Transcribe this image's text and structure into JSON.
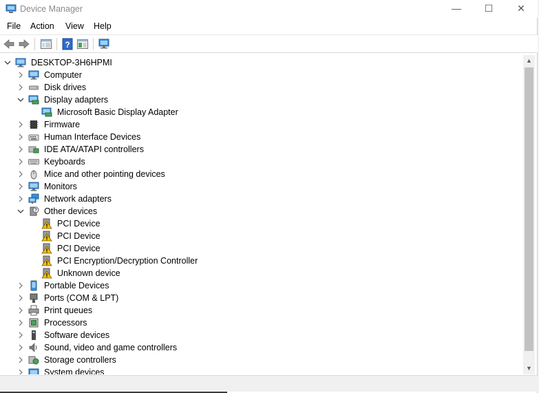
{
  "window": {
    "title": "Device Manager",
    "controls": {
      "minimize": "—",
      "maximize": "☐",
      "close": "✕"
    }
  },
  "menu": [
    {
      "id": "file",
      "label": "File"
    },
    {
      "id": "action",
      "label": "Action"
    },
    {
      "id": "view",
      "label": "View"
    },
    {
      "id": "help",
      "label": "Help"
    }
  ],
  "toolbar": [
    {
      "name": "back-button",
      "icon": "back-arrow-icon"
    },
    {
      "name": "forward-button",
      "icon": "forward-arrow-icon"
    },
    {
      "name": "show-hide-console-tree-button",
      "icon": "console-tree-icon"
    },
    {
      "name": "help-button",
      "icon": "help-icon"
    },
    {
      "name": "properties-button",
      "icon": "properties-icon"
    },
    {
      "name": "scan-hardware-button",
      "icon": "monitor-scan-icon"
    }
  ],
  "tree": {
    "root": "DESKTOP-3H6HPMI",
    "nodes": [
      {
        "label": "Computer",
        "icon": "computer-icon",
        "expanded": false,
        "children": []
      },
      {
        "label": "Disk drives",
        "icon": "disk-drive-icon",
        "expanded": false,
        "children": []
      },
      {
        "label": "Display adapters",
        "icon": "display-adapter-icon",
        "expanded": true,
        "children": [
          {
            "label": "Microsoft Basic Display Adapter",
            "icon": "display-adapter-icon"
          }
        ]
      },
      {
        "label": "Firmware",
        "icon": "firmware-icon",
        "expanded": false,
        "children": []
      },
      {
        "label": "Human Interface Devices",
        "icon": "hid-icon",
        "expanded": false,
        "children": []
      },
      {
        "label": "IDE ATA/ATAPI controllers",
        "icon": "ide-controller-icon",
        "expanded": false,
        "children": []
      },
      {
        "label": "Keyboards",
        "icon": "keyboard-icon",
        "expanded": false,
        "children": []
      },
      {
        "label": "Mice and other pointing devices",
        "icon": "mouse-icon",
        "expanded": false,
        "children": []
      },
      {
        "label": "Monitors",
        "icon": "monitor-icon",
        "expanded": false,
        "children": []
      },
      {
        "label": "Network adapters",
        "icon": "network-adapter-icon",
        "expanded": false,
        "children": []
      },
      {
        "label": "Other devices",
        "icon": "other-devices-icon",
        "expanded": true,
        "children": [
          {
            "label": "PCI Device",
            "icon": "warning-device-icon"
          },
          {
            "label": "PCI Device",
            "icon": "warning-device-icon"
          },
          {
            "label": "PCI Device",
            "icon": "warning-device-icon"
          },
          {
            "label": "PCI Encryption/Decryption Controller",
            "icon": "warning-device-icon"
          },
          {
            "label": "Unknown device",
            "icon": "warning-device-icon"
          }
        ]
      },
      {
        "label": "Portable Devices",
        "icon": "portable-device-icon",
        "expanded": false,
        "children": []
      },
      {
        "label": "Ports (COM & LPT)",
        "icon": "port-icon",
        "expanded": false,
        "children": []
      },
      {
        "label": "Print queues",
        "icon": "printer-icon",
        "expanded": false,
        "children": []
      },
      {
        "label": "Processors",
        "icon": "processor-icon",
        "expanded": false,
        "children": []
      },
      {
        "label": "Software devices",
        "icon": "software-device-icon",
        "expanded": false,
        "children": []
      },
      {
        "label": "Sound, video and game controllers",
        "icon": "sound-icon",
        "expanded": false,
        "children": []
      },
      {
        "label": "Storage controllers",
        "icon": "storage-controller-icon",
        "expanded": false,
        "children": []
      },
      {
        "label": "System devices",
        "icon": "system-devices-icon",
        "expanded": false,
        "children": []
      }
    ]
  },
  "colors": {
    "title_text": "#8a8a8a",
    "warning": "#f7c000",
    "icon_blue": "#3a8ed8",
    "scroll_thumb": "#c2c2c2"
  }
}
